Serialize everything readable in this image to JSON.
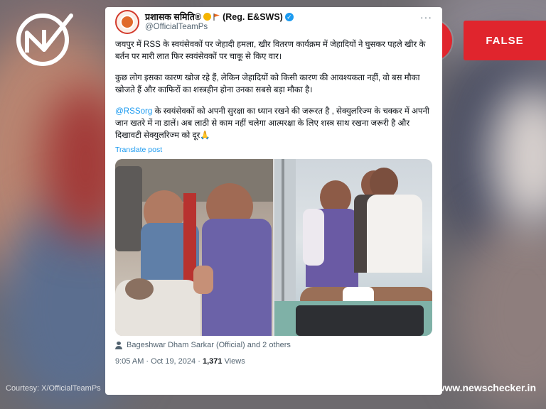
{
  "verdict": {
    "label": "FALSE",
    "alert_glyph": "!",
    "color": "#e0252d"
  },
  "tweet": {
    "display_name": "प्रशासक समिति®",
    "display_tag": "(Reg. E&SWS)",
    "handle": "@OfficialTeamPs",
    "more_glyph": "···",
    "paragraph1": "जयपुर में RSS के स्वयंसेवकों पर जेहादी हमला, खीर वितरण कार्यक्रम में जेहादियों ने घुसकर पहले खीर के बर्तन पर मारी लात फिर स्वयंसेवकों पर चाकू से किए वार।",
    "paragraph2": "कुछ लोग इसका कारण खोज रहे हैं, लेकिन जेहादियों को किसी कारण की आवश्यकता नहीं, वो बस मौका खोजते हैं और काफिरों का शस्त्रहीन होना उनका सबसे बड़ा मौका है।",
    "paragraph3_mention": "@RSSorg",
    "paragraph3_rest": " के स्वयंसेवकों को अपनी सुरक्षा का ध्यान रखने की जरूरत है , सेक्युलरिज्म के चक्कर में अपनी जान खतरे में ना डालें। अब लाठी से काम नहीं चलेगा आत्मरक्षा के लिए शस्त्र साथ रखना जरूरी है और दिखावटी सेक्युलरिज्म को दूर🙏",
    "translate_label": "Translate post",
    "tagged_people": "Bageshwar Dham Sarkar (Official) and 2 others",
    "time": "9:05 AM",
    "date": "Oct 19, 2024",
    "separator": "·",
    "views_count": "1,371",
    "views_label": "Views"
  },
  "footer": {
    "courtesy": "Courtesy: X/OfficialTeamPs",
    "site": "www.newschecker.in"
  }
}
